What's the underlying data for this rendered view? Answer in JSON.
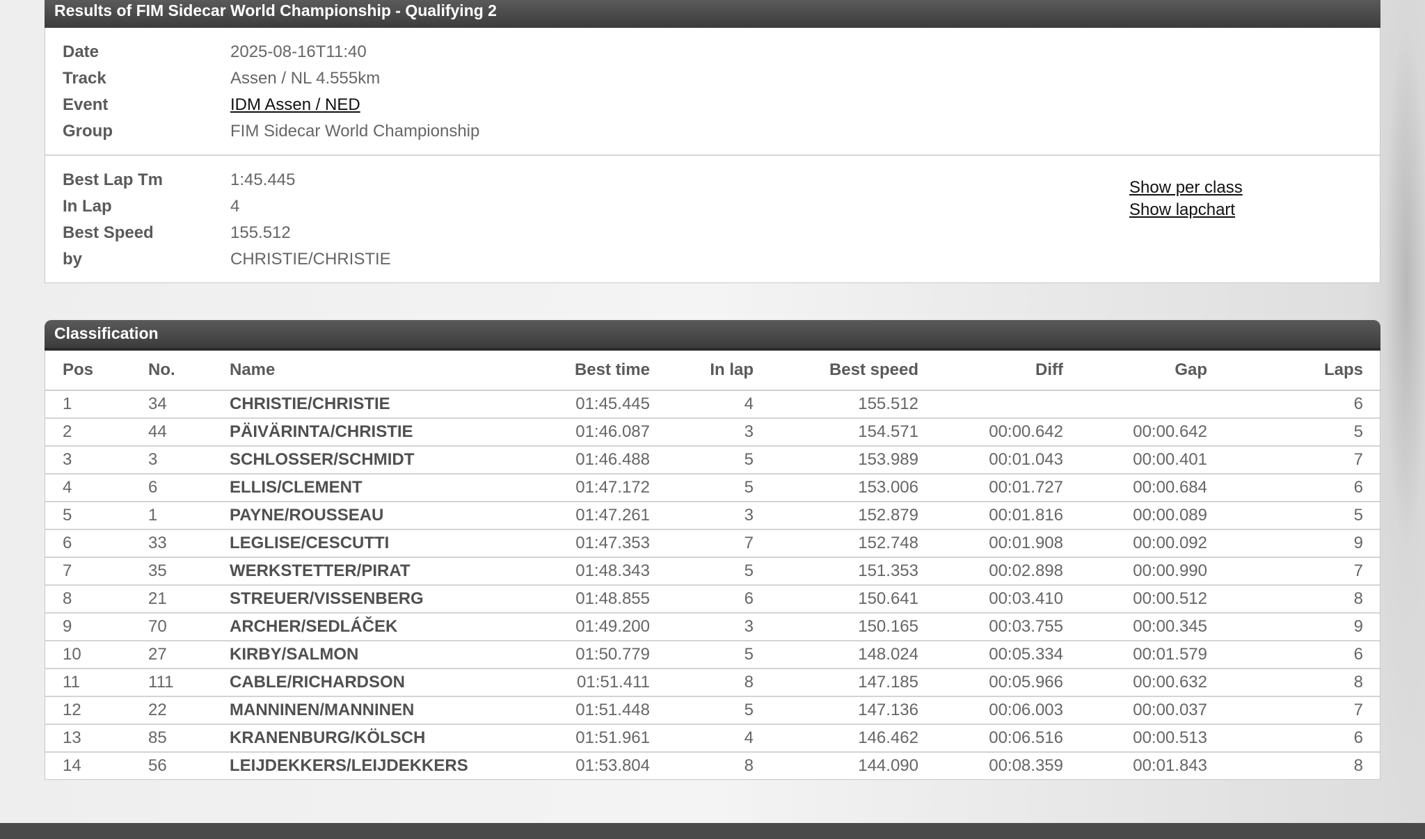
{
  "results": {
    "title": "Results of FIM Sidecar World Championship - Qualifying 2",
    "info": {
      "date_label": "Date",
      "date_value": "2025-08-16T11:40",
      "track_label": "Track",
      "track_value": "Assen / NL 4.555km",
      "event_label": "Event",
      "event_value": "IDM Assen / NED",
      "group_label": "Group",
      "group_value": "FIM Sidecar World Championship"
    },
    "best": {
      "lap_label": "Best Lap Tm",
      "lap_value": "1:45.445",
      "inlap_label": "In Lap",
      "inlap_value": "4",
      "speed_label": "Best Speed",
      "speed_value": "155.512",
      "by_label": "by",
      "by_value": "CHRISTIE/CHRISTIE"
    },
    "links": {
      "per_class": "Show per class",
      "lapchart": "Show lapchart"
    }
  },
  "classification": {
    "title": "Classification",
    "columns": {
      "pos": "Pos",
      "no": "No.",
      "name": "Name",
      "best_time": "Best time",
      "in_lap": "In lap",
      "best_speed": "Best speed",
      "diff": "Diff",
      "gap": "Gap",
      "laps": "Laps"
    },
    "rows": [
      {
        "pos": "1",
        "no": "34",
        "name": "CHRISTIE/CHRISTIE",
        "best_time": "01:45.445",
        "in_lap": "4",
        "best_speed": "155.512",
        "diff": "",
        "gap": "",
        "laps": "6"
      },
      {
        "pos": "2",
        "no": "44",
        "name": "PÄIVÄRINTA/CHRISTIE",
        "best_time": "01:46.087",
        "in_lap": "3",
        "best_speed": "154.571",
        "diff": "00:00.642",
        "gap": "00:00.642",
        "laps": "5"
      },
      {
        "pos": "3",
        "no": "3",
        "name": "SCHLOSSER/SCHMIDT",
        "best_time": "01:46.488",
        "in_lap": "5",
        "best_speed": "153.989",
        "diff": "00:01.043",
        "gap": "00:00.401",
        "laps": "7"
      },
      {
        "pos": "4",
        "no": "6",
        "name": "ELLIS/CLEMENT",
        "best_time": "01:47.172",
        "in_lap": "5",
        "best_speed": "153.006",
        "diff": "00:01.727",
        "gap": "00:00.684",
        "laps": "6"
      },
      {
        "pos": "5",
        "no": "1",
        "name": "PAYNE/ROUSSEAU",
        "best_time": "01:47.261",
        "in_lap": "3",
        "best_speed": "152.879",
        "diff": "00:01.816",
        "gap": "00:00.089",
        "laps": "5"
      },
      {
        "pos": "6",
        "no": "33",
        "name": "LEGLISE/CESCUTTI",
        "best_time": "01:47.353",
        "in_lap": "7",
        "best_speed": "152.748",
        "diff": "00:01.908",
        "gap": "00:00.092",
        "laps": "9"
      },
      {
        "pos": "7",
        "no": "35",
        "name": "WERKSTETTER/PIRAT",
        "best_time": "01:48.343",
        "in_lap": "5",
        "best_speed": "151.353",
        "diff": "00:02.898",
        "gap": "00:00.990",
        "laps": "7"
      },
      {
        "pos": "8",
        "no": "21",
        "name": "STREUER/VISSENBERG",
        "best_time": "01:48.855",
        "in_lap": "6",
        "best_speed": "150.641",
        "diff": "00:03.410",
        "gap": "00:00.512",
        "laps": "8"
      },
      {
        "pos": "9",
        "no": "70",
        "name": "ARCHER/SEDLÁČEK",
        "best_time": "01:49.200",
        "in_lap": "3",
        "best_speed": "150.165",
        "diff": "00:03.755",
        "gap": "00:00.345",
        "laps": "9"
      },
      {
        "pos": "10",
        "no": "27",
        "name": "KIRBY/SALMON",
        "best_time": "01:50.779",
        "in_lap": "5",
        "best_speed": "148.024",
        "diff": "00:05.334",
        "gap": "00:01.579",
        "laps": "6"
      },
      {
        "pos": "11",
        "no": "111",
        "name": "CABLE/RICHARDSON",
        "best_time": "01:51.411",
        "in_lap": "8",
        "best_speed": "147.185",
        "diff": "00:05.966",
        "gap": "00:00.632",
        "laps": "8"
      },
      {
        "pos": "12",
        "no": "22",
        "name": "MANNINEN/MANNINEN",
        "best_time": "01:51.448",
        "in_lap": "5",
        "best_speed": "147.136",
        "diff": "00:06.003",
        "gap": "00:00.037",
        "laps": "7"
      },
      {
        "pos": "13",
        "no": "85",
        "name": "KRANENBURG/KÖLSCH",
        "best_time": "01:51.961",
        "in_lap": "4",
        "best_speed": "146.462",
        "diff": "00:06.516",
        "gap": "00:00.513",
        "laps": "6"
      },
      {
        "pos": "14",
        "no": "56",
        "name": "LEIJDEKKERS/LEIJDEKKERS",
        "best_time": "01:53.804",
        "in_lap": "8",
        "best_speed": "144.090",
        "diff": "00:08.359",
        "gap": "00:01.843",
        "laps": "8"
      }
    ]
  }
}
